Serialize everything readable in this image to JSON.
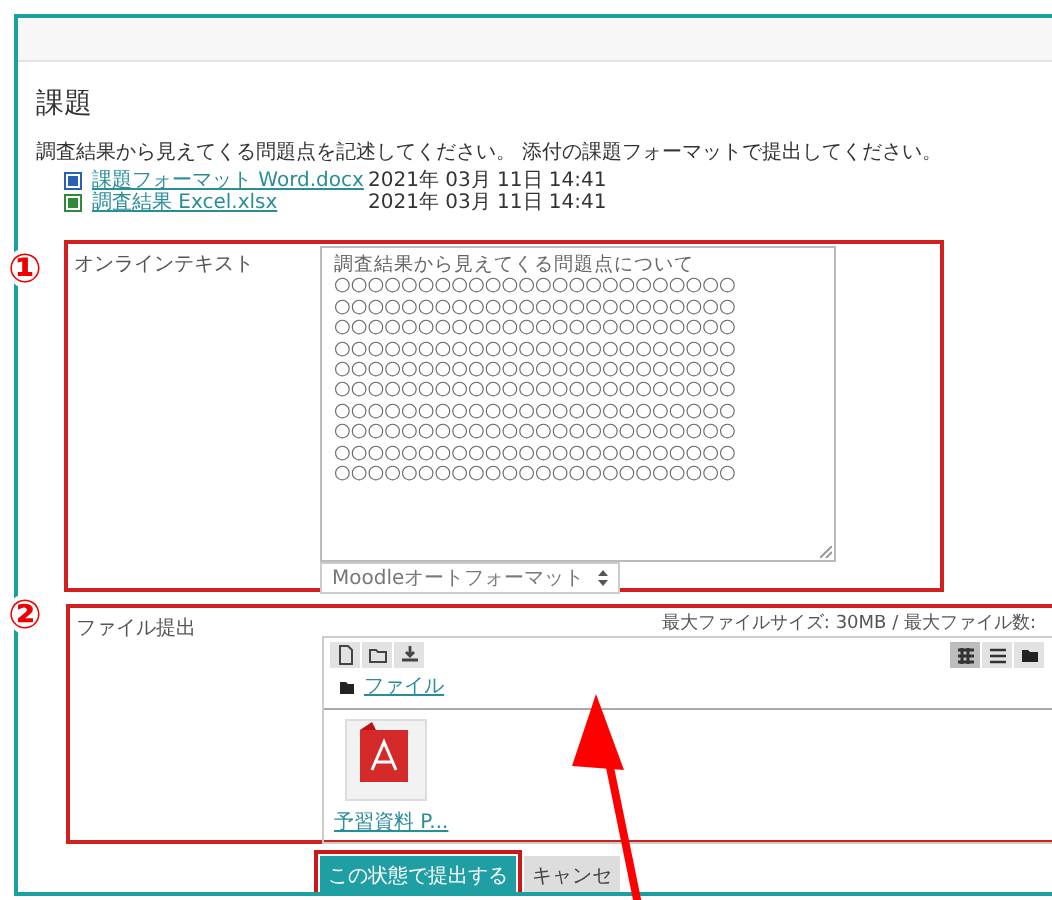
{
  "page": {
    "title": "課題",
    "description": "調査結果から見えてくる問題点を記述してください。 添付の課題フォーマットで提出してください。",
    "attachments": [
      {
        "name": "課題フォーマット Word.docx",
        "kind": "word",
        "date": "2021年 03月 11日 14:41"
      },
      {
        "name": "調査結果 Excel.xlsx",
        "kind": "excel",
        "date": "2021年 03月 11日 14:41"
      }
    ]
  },
  "online_text": {
    "marker": "①",
    "label": "オンラインテキスト",
    "text_lines": [
      "調査結果から見えてくる問題点について",
      "○○○○○○○○○○○○○○○○○○○○○○○○",
      "○○○○○○○○○○○○○○○○○○○○○○○○",
      "○○○○○○○○○○○○○○○○○○○○○○○○",
      "○○○○○○○○○○○○○○○○○○○○○○○○",
      "○○○○○○○○○○○○○○○○○○○○○○○○",
      "○○○○○○○○○○○○○○○○○○○○○○○○",
      "○○○○○○○○○○○○○○○○○○○○○○○○",
      "○○○○○○○○○○○○○○○○○○○○○○○○",
      "○○○○○○○○○○○○○○○○○○○○○○○○",
      "○○○○○○○○○○○○○○○○○○○○○○○○"
    ],
    "format_select": "Moodleオートフォーマット"
  },
  "file_submission": {
    "marker": "②",
    "label": "ファイル提出",
    "limits": "最大ファイルサイズ: 30MB / 最大ファイル数:",
    "path": "ファイル",
    "files": [
      {
        "name": "予習資料 P...",
        "kind": "pdf"
      }
    ],
    "views": [
      {
        "kind": "grid",
        "selected": true
      },
      {
        "kind": "list",
        "selected": false
      },
      {
        "kind": "tree",
        "selected": false
      }
    ]
  },
  "buttons": [
    {
      "label": "この状態で提出する",
      "kind": "primary",
      "highlighted": true
    },
    {
      "label": "キャンセ",
      "kind": "secondary",
      "highlighted": false
    }
  ]
}
